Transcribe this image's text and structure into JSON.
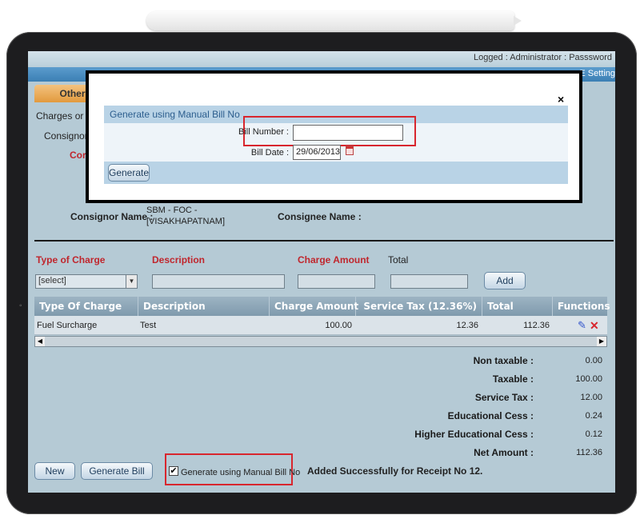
{
  "header": {
    "logged_text": "Logged : Administrator : Passsword",
    "settings_tab": "E Setting",
    "other_tab": "Other"
  },
  "form": {
    "charges_label": "Charges or",
    "consignor_label_partial": "Consignor",
    "red_label_partial": "Cor",
    "consignor_name_label": "Consignor Name :",
    "consignor_name_value_line1": "SBM - FOC -",
    "consignor_name_value_line2": "[VISAKHAPATNAM]",
    "consignee_name_label": "Consignee Name :"
  },
  "charge_entry": {
    "type_label": "Type of Charge",
    "description_label": "Description",
    "amount_label": "Charge Amount",
    "total_label": "Total",
    "select_value": "[select]",
    "add_button": "Add"
  },
  "grid": {
    "headers": [
      "Type Of Charge",
      "Description",
      "Charge Amount",
      "Service Tax (12.36%)",
      "Total",
      "Functions"
    ],
    "rows": [
      {
        "type": "Fuel Surcharge",
        "description": "Test",
        "amount": "100.00",
        "tax": "12.36",
        "total": "112.36"
      }
    ]
  },
  "summary": {
    "non_taxable_label": "Non taxable :",
    "non_taxable_value": "0.00",
    "taxable_label": "Taxable :",
    "taxable_value": "100.00",
    "service_tax_label": "Service Tax :",
    "service_tax_value": "12.00",
    "edu_cess_label": "Educational Cess :",
    "edu_cess_value": "0.24",
    "higher_edu_cess_label": "Higher Educational Cess :",
    "higher_edu_cess_value": "0.12",
    "net_amount_label": "Net Amount :",
    "net_amount_value": "112.36"
  },
  "footer": {
    "new_button": "New",
    "generate_bill_button": "Generate Bill",
    "manual_checkbox_label": "Generate using Manual Bill No",
    "checkbox_mark": "✔",
    "status_message": "Added Successfully for Receipt No 12."
  },
  "modal": {
    "close": "×",
    "title": "Generate using Manual Bill No",
    "bill_number_label": "Bill Number :",
    "bill_number_value": "",
    "bill_date_label": "Bill Date :",
    "bill_date_value": "29/06/2013",
    "generate_button": "Generate"
  },
  "colors": {
    "screen_bg": "#b5cad5",
    "accent_red": "#d8262e",
    "grid_header": "#8aa4b6",
    "modal_header": "#b9d3e6"
  }
}
